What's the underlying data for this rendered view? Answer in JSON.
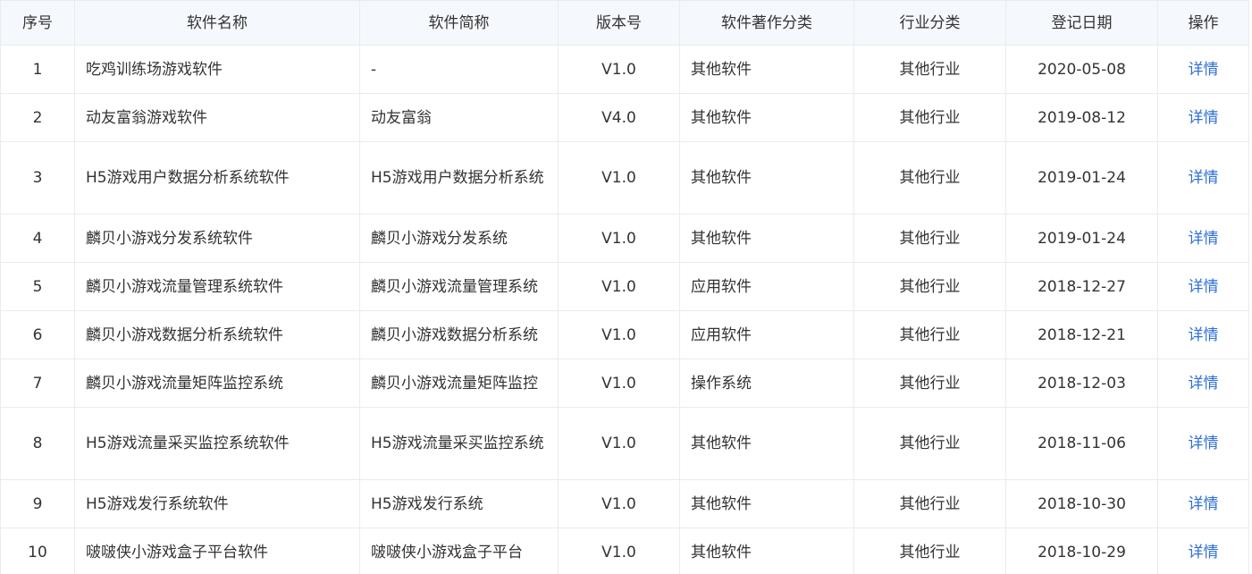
{
  "table": {
    "headers": [
      "序号",
      "软件名称",
      "软件简称",
      "版本号",
      "软件著作分类",
      "行业分类",
      "登记日期",
      "操作"
    ],
    "rows": [
      {
        "no": "1",
        "name": "吃鸡训练场游戏软件",
        "short": "-",
        "version": "V1.0",
        "category": "其他软件",
        "industry": "其他行业",
        "date": "2020-05-08",
        "action": "详情"
      },
      {
        "no": "2",
        "name": "动友富翁游戏软件",
        "short": "动友富翁",
        "version": "V4.0",
        "category": "其他软件",
        "industry": "其他行业",
        "date": "2019-08-12",
        "action": "详情"
      },
      {
        "no": "3",
        "name": "H5游戏用户数据分析系统软件",
        "short": "H5游戏用户数据分析系统",
        "version": "V1.0",
        "category": "其他软件",
        "industry": "其他行业",
        "date": "2019-01-24",
        "action": "详情"
      },
      {
        "no": "4",
        "name": "麟贝小游戏分发系统软件",
        "short": "麟贝小游戏分发系统",
        "version": "V1.0",
        "category": "其他软件",
        "industry": "其他行业",
        "date": "2019-01-24",
        "action": "详情"
      },
      {
        "no": "5",
        "name": "麟贝小游戏流量管理系统软件",
        "short": "麟贝小游戏流量管理系统",
        "version": "V1.0",
        "category": "应用软件",
        "industry": "其他行业",
        "date": "2018-12-27",
        "action": "详情"
      },
      {
        "no": "6",
        "name": "麟贝小游戏数据分析系统软件",
        "short": "麟贝小游戏数据分析系统",
        "version": "V1.0",
        "category": "应用软件",
        "industry": "其他行业",
        "date": "2018-12-21",
        "action": "详情"
      },
      {
        "no": "7",
        "name": "麟贝小游戏流量矩阵监控系统",
        "short": "麟贝小游戏流量矩阵监控",
        "version": "V1.0",
        "category": "操作系统",
        "industry": "其他行业",
        "date": "2018-12-03",
        "action": "详情"
      },
      {
        "no": "8",
        "name": "H5游戏流量采买监控系统软件",
        "short": "H5游戏流量采买监控系统",
        "version": "V1.0",
        "category": "其他软件",
        "industry": "其他行业",
        "date": "2018-11-06",
        "action": "详情"
      },
      {
        "no": "9",
        "name": "H5游戏发行系统软件",
        "short": "H5游戏发行系统",
        "version": "V1.0",
        "category": "其他软件",
        "industry": "其他行业",
        "date": "2018-10-30",
        "action": "详情"
      },
      {
        "no": "10",
        "name": "啵啵侠小游戏盒子平台软件",
        "short": "啵啵侠小游戏盒子平台",
        "version": "V1.0",
        "category": "其他软件",
        "industry": "其他行业",
        "date": "2018-10-29",
        "action": "详情"
      }
    ]
  },
  "colors": {
    "header_bg": "#f5f8fc",
    "border": "#e8ebf0",
    "text": "#333333",
    "link": "#2e6fd6"
  }
}
